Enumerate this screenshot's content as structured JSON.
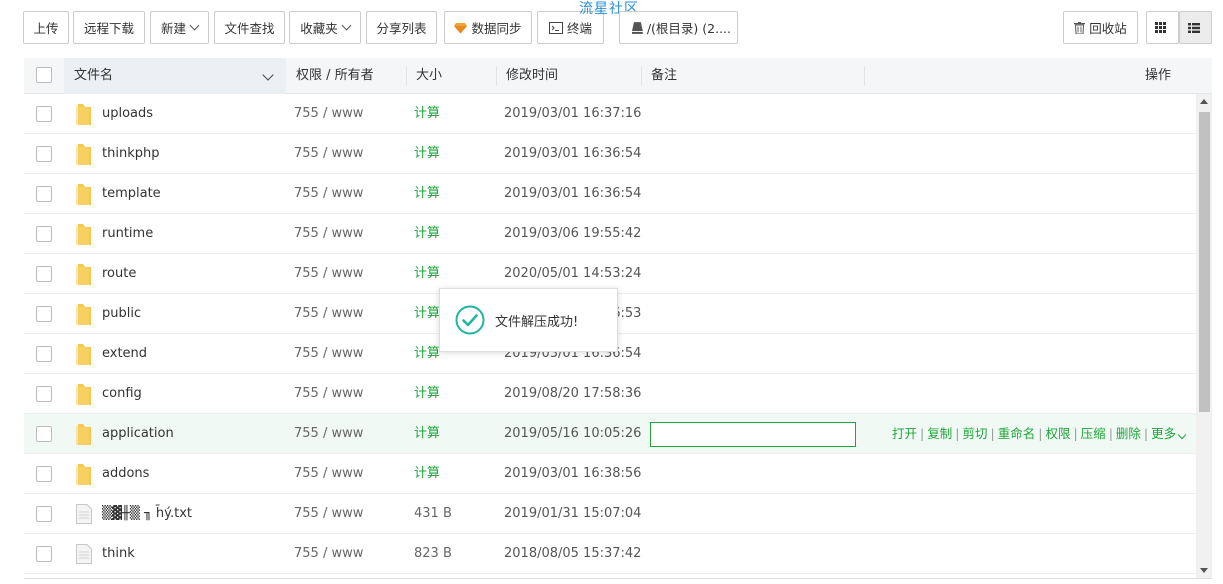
{
  "toolbar": {
    "upload": "上传",
    "remote_download": "远程下载",
    "new": "新建",
    "file_search": "文件查找",
    "favorites": "收藏夹",
    "share_list": "分享列表",
    "data_sync": "数据同步",
    "terminal": "终端",
    "path": "/(根目录) (2....",
    "recycle_bin": "回收站",
    "view_grid_icon": "grid-icon",
    "view_list_icon": "list-icon"
  },
  "watermark": "流星社区",
  "table": {
    "headers": {
      "name": "文件名",
      "perm": "权限 / 所有者",
      "size": "大小",
      "mtime": "修改时间",
      "remark": "备注",
      "ops": "操作"
    },
    "rows": [
      {
        "name": "uploads",
        "type": "folder",
        "perm": "755 / www",
        "size": "计算",
        "mtime": "2019/03/01 16:37:16"
      },
      {
        "name": "thinkphp",
        "type": "folder",
        "perm": "755 / www",
        "size": "计算",
        "mtime": "2019/03/01 16:36:54"
      },
      {
        "name": "template",
        "type": "folder",
        "perm": "755 / www",
        "size": "计算",
        "mtime": "2019/03/01 16:36:54"
      },
      {
        "name": "runtime",
        "type": "folder",
        "perm": "755 / www",
        "size": "计算",
        "mtime": "2019/03/06 19:55:42"
      },
      {
        "name": "route",
        "type": "folder",
        "perm": "755 / www",
        "size": "计算",
        "mtime": "2020/05/01 14:53:24"
      },
      {
        "name": "public",
        "type": "folder",
        "perm": "755 / www",
        "size": "计算",
        "mtime": "2019/03/01 16:36:53"
      },
      {
        "name": "extend",
        "type": "folder",
        "perm": "755 / www",
        "size": "计算",
        "mtime": "2019/03/01 16:36:54"
      },
      {
        "name": "config",
        "type": "folder",
        "perm": "755 / www",
        "size": "计算",
        "mtime": "2019/08/20 17:58:36"
      },
      {
        "name": "application",
        "type": "folder",
        "perm": "755 / www",
        "size": "计算",
        "mtime": "2019/05/16 10:05:26"
      },
      {
        "name": "addons",
        "type": "folder",
        "perm": "755 / www",
        "size": "计算",
        "mtime": "2019/03/01 16:38:56"
      },
      {
        "name": "▒▓╫▒ ╖ h̄ý.txt",
        "type": "file",
        "perm": "755 / www",
        "size": "431 B",
        "mtime": "2019/01/31 15:07:04"
      },
      {
        "name": "think",
        "type": "file",
        "perm": "755 / www",
        "size": "823 B",
        "mtime": "2018/08/05 15:37:42"
      }
    ],
    "active_row_ops": [
      "打开",
      "复制",
      "剪切",
      "重命名",
      "权限",
      "压缩",
      "删除",
      "更多"
    ]
  },
  "toast": {
    "message": "文件解压成功!"
  },
  "colors": {
    "accent": "#20a53a",
    "folder": "#f7c64a",
    "watermark": "#2b8fd8"
  }
}
